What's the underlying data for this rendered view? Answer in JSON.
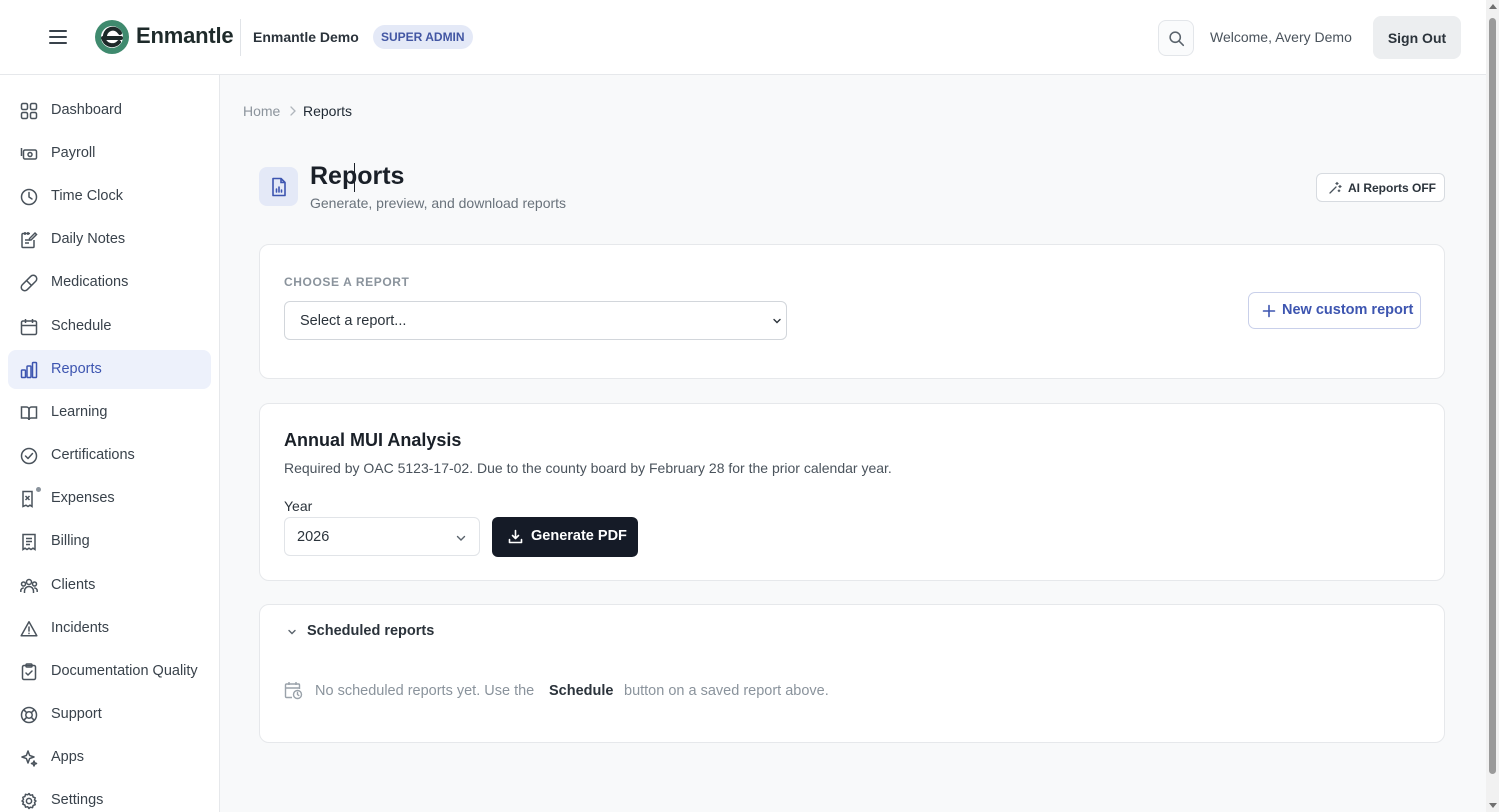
{
  "header": {
    "logo_text": "Enmantle",
    "org_name": "Enmantle Demo",
    "role_badge": "SUPER ADMIN",
    "welcome": "Welcome, Avery Demo",
    "signout_label": "Sign Out"
  },
  "sidebar": {
    "items": [
      {
        "label": "Dashboard",
        "icon": "grid-icon"
      },
      {
        "label": "Payroll",
        "icon": "money-icon"
      },
      {
        "label": "Time Clock",
        "icon": "clock-icon"
      },
      {
        "label": "Daily Notes",
        "icon": "notes-icon"
      },
      {
        "label": "Medications",
        "icon": "pill-icon"
      },
      {
        "label": "Schedule",
        "icon": "calendar-icon"
      },
      {
        "label": "Reports",
        "icon": "bar-chart-icon",
        "active": true
      },
      {
        "label": "Learning",
        "icon": "book-icon"
      },
      {
        "label": "Certifications",
        "icon": "check-circle-icon"
      },
      {
        "label": "Expenses",
        "icon": "receipt-icon"
      },
      {
        "label": "Billing",
        "icon": "invoice-icon"
      },
      {
        "label": "Clients",
        "icon": "users-icon"
      },
      {
        "label": "Incidents",
        "icon": "warning-icon"
      },
      {
        "label": "Documentation Quality",
        "icon": "clipboard-check-icon"
      },
      {
        "label": "Support",
        "icon": "lifebuoy-icon"
      },
      {
        "label": "Apps",
        "icon": "sparkle-icon"
      },
      {
        "label": "Settings",
        "icon": "gear-icon"
      }
    ]
  },
  "breadcrumb": {
    "home": "Home",
    "current": "Reports"
  },
  "page": {
    "title": "Reports",
    "subtitle": "Generate, preview, and download reports",
    "ai_toggle_label": "AI Reports OFF"
  },
  "chooser": {
    "label": "CHOOSE A REPORT",
    "placeholder": "Select a report...",
    "new_custom_label": "New custom report"
  },
  "report": {
    "title": "Annual MUI Analysis",
    "description": "Required by OAC 5123-17-02. Due to the county board by February 28 for the prior calendar year.",
    "year_label": "Year",
    "year_value": "2026",
    "generate_label": "Generate PDF"
  },
  "scheduled": {
    "title": "Scheduled reports",
    "empty_prefix": "No scheduled reports yet. Use the",
    "empty_bold": "Schedule",
    "empty_suffix": "button on a saved report above."
  },
  "colors": {
    "accent": "#3d55b0",
    "active_bg": "#edf1fb",
    "primary_button": "#151b27",
    "logo_green": "#3f8a6e"
  }
}
